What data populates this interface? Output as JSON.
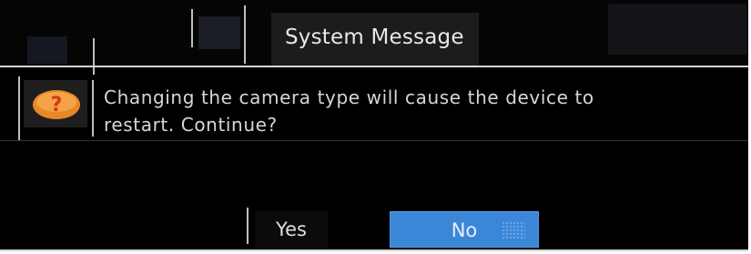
{
  "dialog": {
    "title": "System Message",
    "message": "Changing the camera type will cause the device to restart. Continue?",
    "icon": "question-icon",
    "buttons": {
      "yes_label": "Yes",
      "no_label": "No"
    },
    "colors": {
      "background": "#000000",
      "accent_button": "#3c86d8",
      "icon_orange": "#e8872a",
      "icon_red": "#d33a1c"
    }
  }
}
